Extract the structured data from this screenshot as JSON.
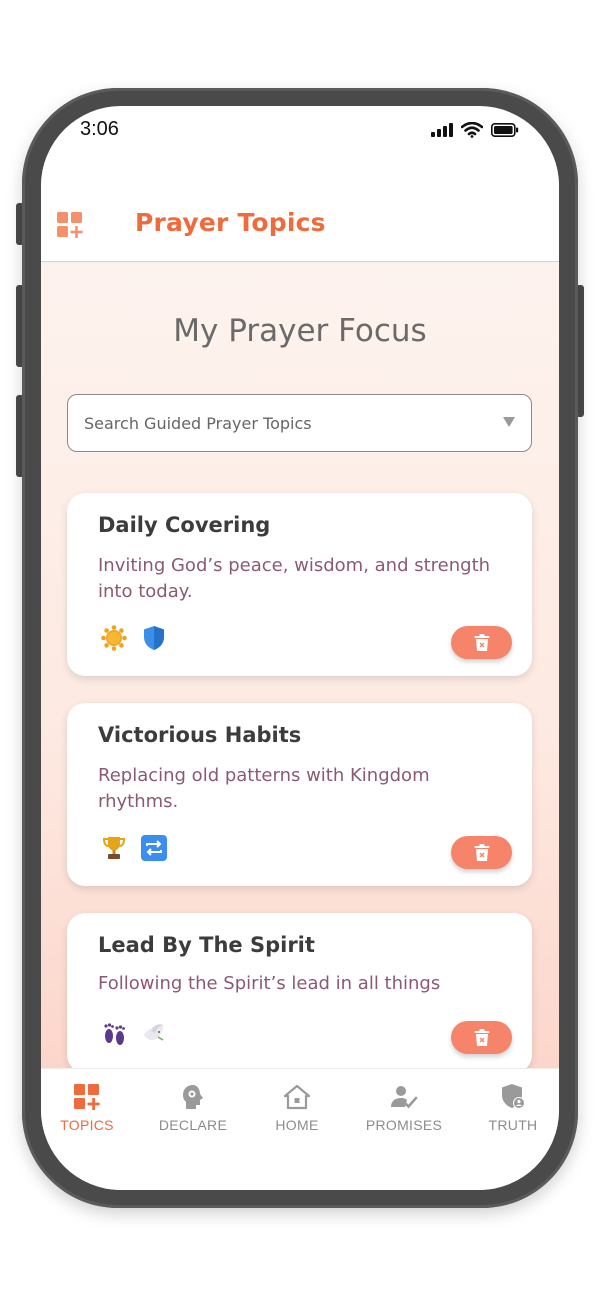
{
  "status_bar": {
    "time": "3:06",
    "icons": [
      "signal-icon",
      "wifi-icon",
      "battery-icon"
    ]
  },
  "header": {
    "title": "Prayer Topics",
    "left_icon": "grid-add-icon",
    "accent_color": "#ef6a3c"
  },
  "main": {
    "page_title": "My Prayer Focus",
    "search": {
      "placeholder": "Search Guided Prayer Topics",
      "value": ""
    },
    "cards": [
      {
        "title": "Daily Covering",
        "description": "Inviting God’s peace, wisdom, and strength into today.",
        "icons": [
          "sun-icon",
          "shield-icon"
        ]
      },
      {
        "title": "Victorious Habits",
        "description": "Replacing old patterns with Kingdom rhythms.",
        "icons": [
          "trophy-icon",
          "repeat-icon"
        ]
      },
      {
        "title": "Lead By The Spirit",
        "description": "Following the Spirit’s lead in all things",
        "icons": [
          "footprints-icon",
          "dove-icon"
        ]
      }
    ],
    "delete_icon": "trash-icon"
  },
  "bottom_nav": {
    "items": [
      {
        "label": "TOPICS",
        "icon": "grid-add-icon",
        "active": true
      },
      {
        "label": "DECLARE",
        "icon": "head-icon",
        "active": false
      },
      {
        "label": "HOME",
        "icon": "home-icon",
        "active": false
      },
      {
        "label": "PROMISES",
        "icon": "person-check-icon",
        "active": false
      },
      {
        "label": "TRUTH",
        "icon": "shield-person-icon",
        "active": false
      }
    ]
  },
  "colors": {
    "accent": "#ef6a3c",
    "delete_button": "#f5846a",
    "description_text": "#8b5a72"
  }
}
